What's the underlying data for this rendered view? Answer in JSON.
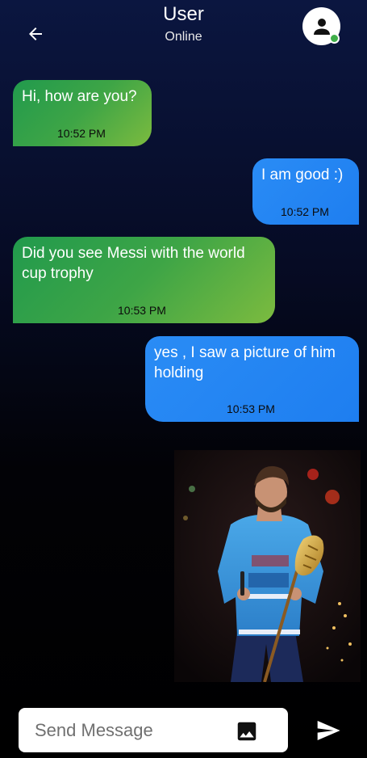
{
  "header": {
    "title": "User",
    "status": "Online",
    "back_icon": "arrow-left-icon",
    "avatar_icon": "person-icon",
    "status_color": "#3fae49"
  },
  "messages": [
    {
      "direction": "incoming",
      "text": "Hi, how are you?",
      "time": "10:52 PM"
    },
    {
      "direction": "outgoing",
      "text": "I am good :)",
      "time": "10:52 PM"
    },
    {
      "direction": "incoming",
      "text": "Did you see Messi with the world cup trophy",
      "time": "10:53 PM"
    },
    {
      "direction": "outgoing",
      "text": "yes , I saw a picture of him holding",
      "time": "10:53 PM"
    },
    {
      "direction": "outgoing",
      "type": "image",
      "image_icon": "photo-messi-trophy"
    }
  ],
  "composer": {
    "placeholder": "Send Message",
    "value": "",
    "attach_icon": "image-icon",
    "send_icon": "send-icon"
  },
  "colors": {
    "incoming_bubble": "#3ea546",
    "outgoing_bubble": "#2a8cf5",
    "background_top": "#0b1640",
    "background_bottom": "#000000"
  }
}
